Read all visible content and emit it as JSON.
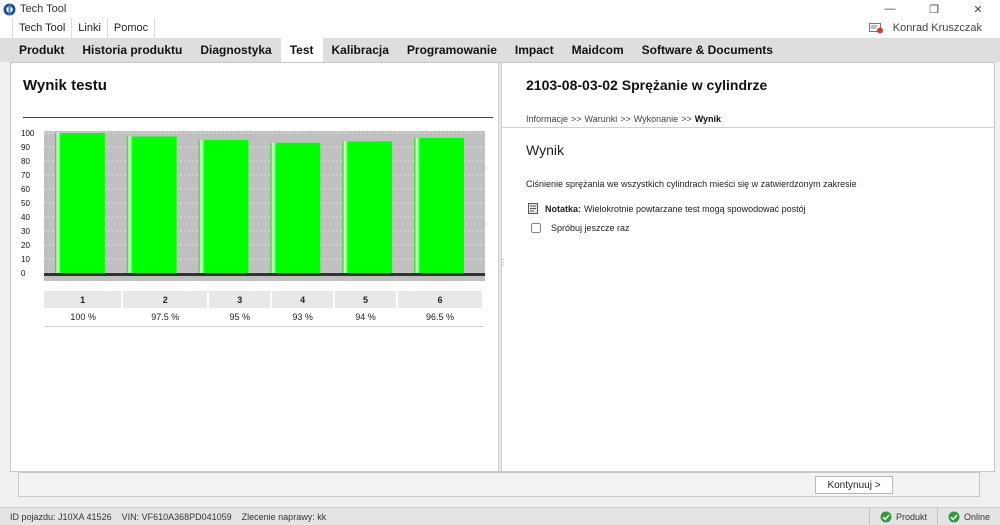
{
  "window": {
    "title": "Tech Tool",
    "minimize": "—",
    "restore": "❐",
    "close": "✕"
  },
  "menubar": {
    "items": [
      "Tech Tool",
      "Linki",
      "Pomoc"
    ],
    "user": "Konrad Kruszczak"
  },
  "tabs": [
    {
      "label": "Produkt",
      "active": false
    },
    {
      "label": "Historia produktu",
      "active": false
    },
    {
      "label": "Diagnostyka",
      "active": false
    },
    {
      "label": "Test",
      "active": true
    },
    {
      "label": "Kalibracja",
      "active": false
    },
    {
      "label": "Programowanie",
      "active": false
    },
    {
      "label": "Impact",
      "active": false
    },
    {
      "label": "Maidcom",
      "active": false
    },
    {
      "label": "Software & Documents",
      "active": false
    }
  ],
  "left_panel": {
    "title": "Wynik testu",
    "columns": [
      "1",
      "2",
      "3",
      "4",
      "5",
      "6"
    ],
    "values": [
      "100 %",
      "97.5 %",
      "95 %",
      "93 %",
      "94 %",
      "96.5 %"
    ]
  },
  "chart_data": {
    "type": "bar",
    "categories": [
      "1",
      "2",
      "3",
      "4",
      "5",
      "6"
    ],
    "series": [
      {
        "values": [
          100,
          97.5,
          95,
          93,
          94,
          96.5
        ]
      }
    ],
    "ylim": [
      0,
      100
    ],
    "yticks": [
      "100",
      "90",
      "80",
      "70",
      "60",
      "50",
      "40",
      "30",
      "20",
      "10",
      "0"
    ],
    "grid": true,
    "bar_color": "#00ff00",
    "background_color": "#c0c0c0"
  },
  "right_panel": {
    "test_title": "2103-08-03-02 Sprężanie w cylindrze",
    "breadcrumb": [
      "Informacje",
      ">>",
      "Warunki",
      ">>",
      "Wykonanie",
      ">>",
      "Wynik"
    ],
    "result_heading": "Wynik",
    "result_text": "Ciśnienie sprężania we wszystkich cylindrach mieści się w zatwierdzonym zakresie",
    "note_label": "Notatka:",
    "note_text": "Wielokrotnie powtarzane test mogą spowodować postój",
    "retry_label": "Spróbuj jeszcze raz"
  },
  "bottombar": {
    "continue_label": "Kontynuuj >"
  },
  "statusbar": {
    "vehicle_id": "ID pojazdu: J10XA 41526",
    "vin": "VIN: VF610A368PD041059",
    "order": "Zlecenie naprawy: kk",
    "product": "Produkt",
    "online": "Online",
    "ok_color": "#2e9e3a"
  }
}
